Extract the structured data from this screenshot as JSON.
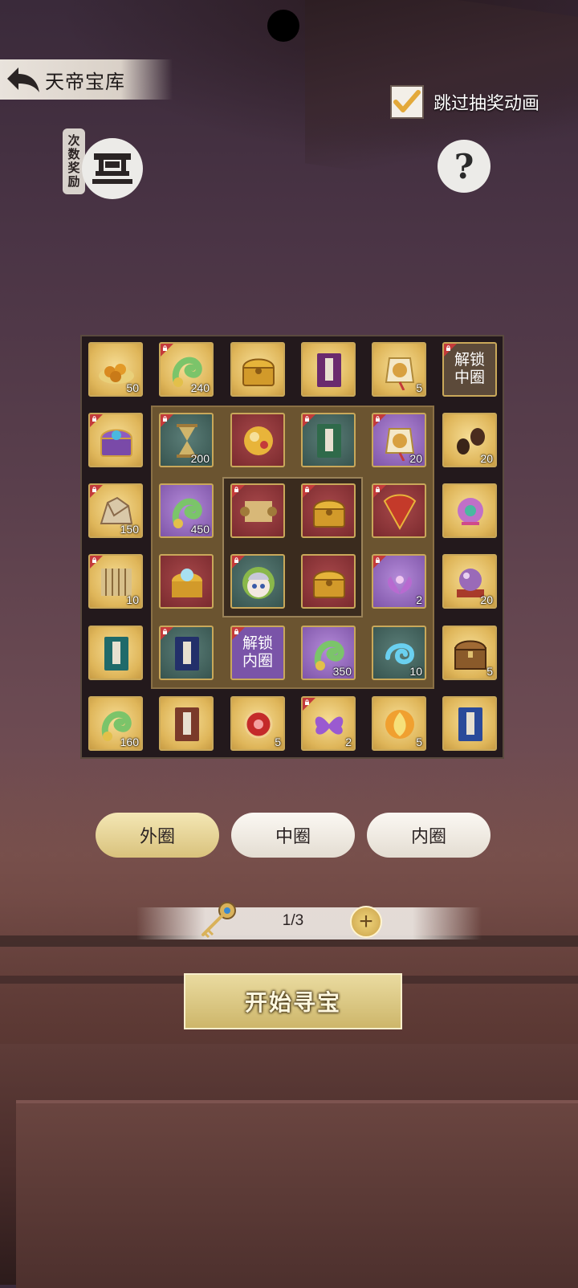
{
  "header": {
    "title": "天帝宝库",
    "skip_label": "跳过抽奖动画",
    "skip_checked": true,
    "count_reward_label": [
      "次",
      "数",
      "奖",
      "励"
    ],
    "help_label": "?"
  },
  "board": {
    "cells": [
      {
        "id": "r0c0",
        "art": "nuts",
        "qty": "50",
        "locked": false,
        "bg": "gold"
      },
      {
        "id": "r0c1",
        "art": "jade",
        "qty": "240",
        "locked": true,
        "bg": "gold"
      },
      {
        "id": "r0c2",
        "art": "chest",
        "qty": "",
        "locked": false,
        "bg": "gold"
      },
      {
        "id": "r0c3",
        "art": "book-purple",
        "qty": "",
        "locked": false,
        "bg": "gold"
      },
      {
        "id": "r0c4",
        "art": "token",
        "qty": "5",
        "locked": false,
        "bg": "gold"
      },
      {
        "id": "r0c5",
        "text": "解锁\n中圈",
        "locked": true,
        "bg": "lock"
      },
      {
        "id": "r1c0",
        "art": "chest-purple",
        "qty": "",
        "locked": true,
        "bg": "gold"
      },
      {
        "id": "r1c1",
        "art": "hourglass",
        "qty": "200",
        "locked": true,
        "bg": "teal"
      },
      {
        "id": "r1c2",
        "art": "treasure",
        "qty": "",
        "locked": false,
        "bg": "red"
      },
      {
        "id": "r1c3",
        "art": "book-green",
        "qty": "",
        "locked": true,
        "bg": "teal"
      },
      {
        "id": "r1c4",
        "art": "token",
        "qty": "20",
        "locked": true,
        "bg": "purple"
      },
      {
        "id": "r1c5",
        "art": "seeds",
        "qty": "20",
        "locked": false,
        "bg": "gold"
      },
      {
        "id": "r2c0",
        "art": "rock",
        "qty": "150",
        "locked": true,
        "bg": "gold"
      },
      {
        "id": "r2c1",
        "art": "jade",
        "qty": "450",
        "locked": false,
        "bg": "purple"
      },
      {
        "id": "r2c2",
        "art": "scroll",
        "qty": "",
        "locked": true,
        "bg": "red"
      },
      {
        "id": "r2c3",
        "art": "chest",
        "qty": "",
        "locked": true,
        "bg": "red"
      },
      {
        "id": "r2c4",
        "art": "fan",
        "qty": "",
        "locked": true,
        "bg": "red"
      },
      {
        "id": "r2c5",
        "art": "flower",
        "qty": "",
        "locked": false,
        "bg": "gold"
      },
      {
        "id": "r3c0",
        "art": "bamboo",
        "qty": "10",
        "locked": true,
        "bg": "gold"
      },
      {
        "id": "r3c1",
        "art": "treasure-chest",
        "qty": "",
        "locked": false,
        "bg": "red"
      },
      {
        "id": "r3c2",
        "art": "avatar",
        "qty": "",
        "locked": true,
        "bg": "teal"
      },
      {
        "id": "r3c3",
        "art": "chest",
        "qty": "",
        "locked": false,
        "bg": "red"
      },
      {
        "id": "r3c4",
        "art": "lotus",
        "qty": "2",
        "locked": true,
        "bg": "purple"
      },
      {
        "id": "r3c5",
        "art": "orb",
        "qty": "20",
        "locked": false,
        "bg": "gold"
      },
      {
        "id": "r4c0",
        "art": "book-teal",
        "qty": "",
        "locked": false,
        "bg": "gold"
      },
      {
        "id": "r4c1",
        "art": "book-navy",
        "qty": "",
        "locked": true,
        "bg": "teal"
      },
      {
        "id": "r4c2",
        "text": "解锁\n内圈",
        "locked": true,
        "bg": "lock-purple"
      },
      {
        "id": "r4c3",
        "art": "jade",
        "qty": "350",
        "locked": false,
        "bg": "purple"
      },
      {
        "id": "r4c4",
        "art": "swirl",
        "qty": "10",
        "locked": false,
        "bg": "teal"
      },
      {
        "id": "r4c5",
        "art": "wood-chest",
        "qty": "5",
        "locked": false,
        "bg": "gold"
      },
      {
        "id": "r5c0",
        "art": "jade",
        "qty": "160",
        "locked": false,
        "bg": "gold"
      },
      {
        "id": "r5c1",
        "art": "book-brown",
        "qty": "",
        "locked": false,
        "bg": "gold"
      },
      {
        "id": "r5c2",
        "art": "red-orb",
        "qty": "5",
        "locked": false,
        "bg": "gold"
      },
      {
        "id": "r5c3",
        "art": "butterfly",
        "qty": "2",
        "locked": true,
        "bg": "gold"
      },
      {
        "id": "r5c4",
        "art": "fire",
        "qty": "5",
        "locked": false,
        "bg": "gold"
      },
      {
        "id": "r5c5",
        "art": "book-blue",
        "qty": "",
        "locked": false,
        "bg": "gold"
      }
    ]
  },
  "ring_tabs": {
    "outer": "外圈",
    "middle": "中圈",
    "inner": "内圈",
    "active": "outer"
  },
  "keys": {
    "count": "1/3",
    "plus": "+"
  },
  "start_button": "开始寻宝",
  "colors": {
    "gold_cell": "#dfb65a",
    "purple_cell": "#7e55a8",
    "teal_cell": "#37544f",
    "red_cell": "#7a2a2e",
    "lock_badge": "#c43a3a"
  }
}
